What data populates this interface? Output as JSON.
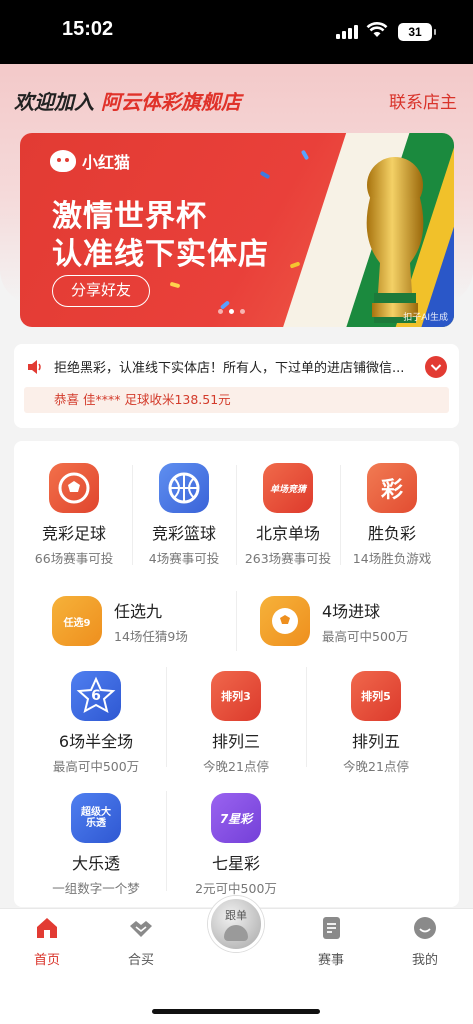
{
  "status_bar": {
    "time": "15:02",
    "battery": "31"
  },
  "header": {
    "welcome_prefix": "欢迎加入",
    "store_name": "阿云体彩旗舰店",
    "contact_label": "联系店主"
  },
  "banner": {
    "brand": "小红猫",
    "line1": "激情世界杯",
    "line2": "认准线下实体店",
    "share_label": "分享好友",
    "ai_mark": "扣子AI生成",
    "active_slide": 2,
    "slide_count": 3
  },
  "notice": {
    "text": "拒绝黑彩，认准线下实体店！所有人，下过单的进店铺微信...",
    "winner": "恭喜 佳**** 足球收米138.51元"
  },
  "games": [
    {
      "name": "竞彩足球",
      "sub": "66场赛事可投",
      "icon": "football-icon",
      "glyph": ""
    },
    {
      "name": "竞彩篮球",
      "sub": "4场赛事可投",
      "icon": "basketball-icon",
      "glyph": ""
    },
    {
      "name": "北京单场",
      "sub": "263场赛事可投",
      "icon": "beijing-single-icon",
      "glyph": "单场竞猜"
    },
    {
      "name": "胜负彩",
      "sub": "14场胜负游戏",
      "icon": "win-lose-icon",
      "glyph": "彩"
    },
    {
      "name": "任选九",
      "sub": "14场任猜9场",
      "icon": "pick-nine-icon",
      "glyph": "任选9"
    },
    {
      "name": "4场进球",
      "sub": "最高可中500万",
      "icon": "four-goals-icon",
      "glyph": ""
    },
    {
      "name": "6场半全场",
      "sub": "最高可中500万",
      "icon": "six-half-full-icon",
      "glyph": "6"
    },
    {
      "name": "排列三",
      "sub": "今晚21点停",
      "icon": "pick-three-icon",
      "glyph": "排列3"
    },
    {
      "name": "排列五",
      "sub": "今晚21点停",
      "icon": "pick-five-icon",
      "glyph": "排列5"
    },
    {
      "name": "大乐透",
      "sub": "一组数字一个梦",
      "icon": "super-lotto-icon",
      "glyph": "超级大乐透"
    },
    {
      "name": "七星彩",
      "sub": "2元可中500万",
      "icon": "seven-star-icon",
      "glyph": "7星彩"
    }
  ],
  "tabbar": {
    "home": "首页",
    "group_buy": "合买",
    "follow": "跟单",
    "matches": "赛事",
    "mine": "我的"
  },
  "colors": {
    "accent": "#e23b33",
    "notice_bg": "#fbefe9"
  }
}
